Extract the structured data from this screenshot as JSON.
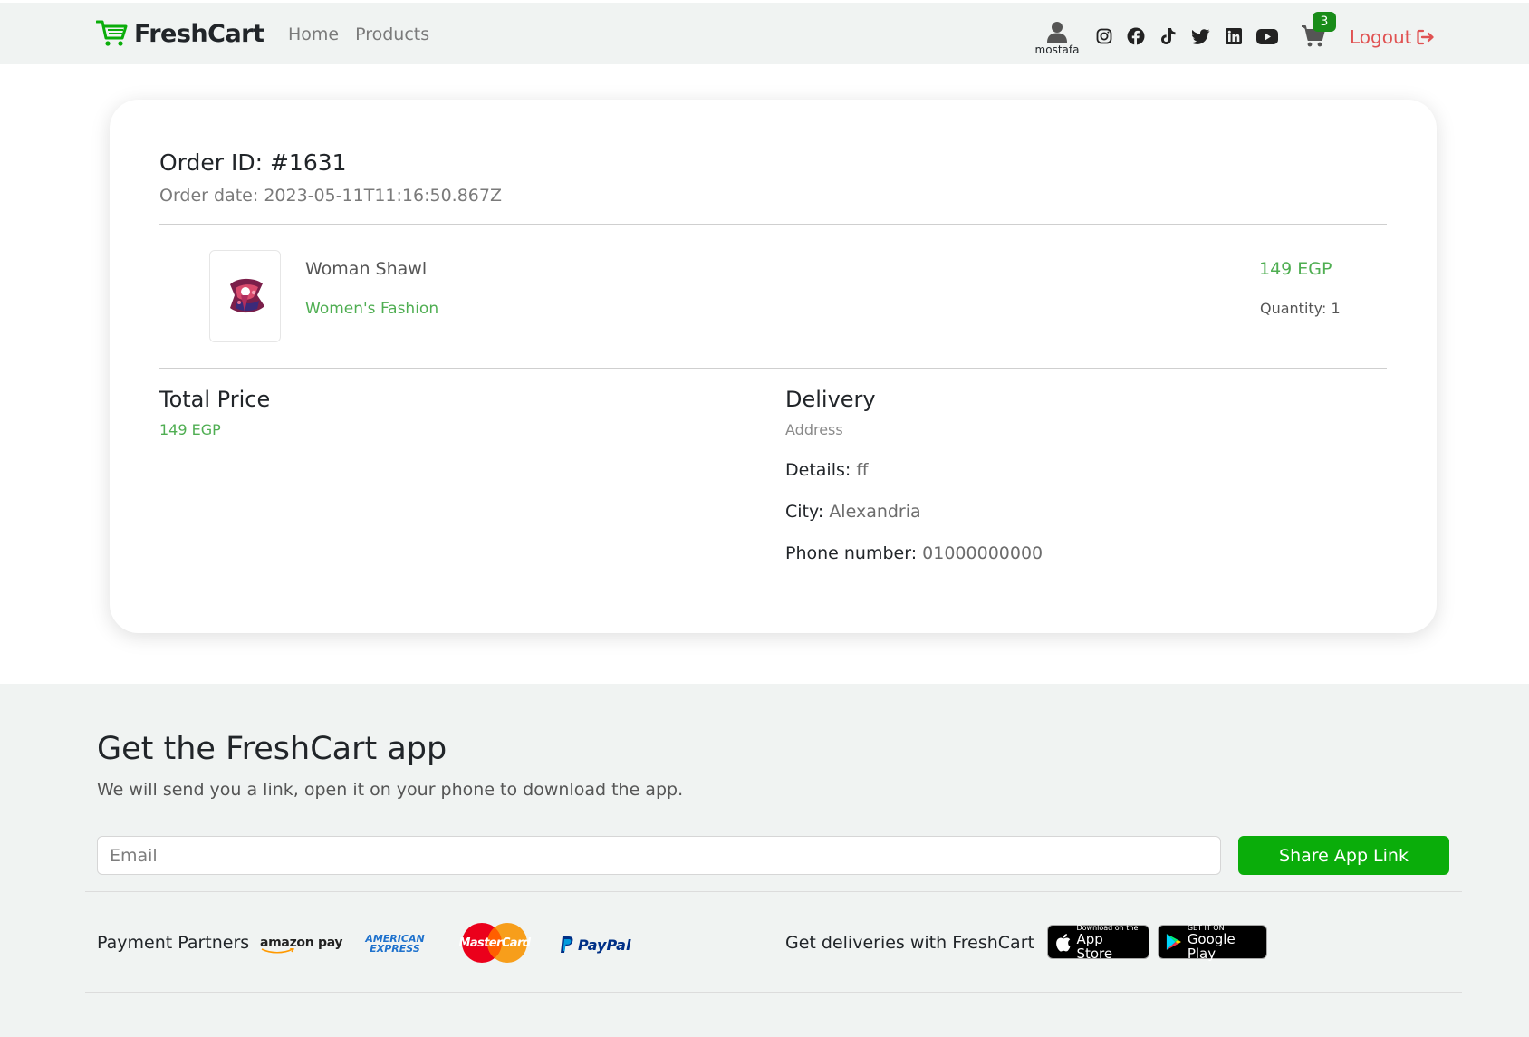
{
  "nav": {
    "brand": "FreshCart",
    "links": [
      "Home",
      "Products"
    ],
    "user_name": "mostafa",
    "social_icons": [
      "instagram-icon",
      "facebook-icon",
      "tiktok-icon",
      "twitter-icon",
      "linkedin-icon",
      "youtube-icon"
    ],
    "cart_count": "3",
    "logout_label": "Logout"
  },
  "order": {
    "title": "Order ID: #1631",
    "date": "Order date: 2023-05-11T11:16:50.867Z",
    "item": {
      "name": "Woman Shawl",
      "category": "Women's Fashion",
      "price": "149 EGP",
      "quantity": "Quantity: 1"
    },
    "total_heading": "Total Price",
    "total_value": "149 EGP",
    "delivery_heading": "Delivery",
    "delivery_sub": "Address",
    "details_label": "Details:",
    "details_value": "ff",
    "city_label": "City:",
    "city_value": "Alexandria",
    "phone_label": "Phone number:",
    "phone_value": "01000000000"
  },
  "footer": {
    "app_title": "Get the FreshCart app",
    "app_sub": "We will send you a link, open it on your phone to download the app.",
    "email_placeholder": "Email",
    "share_button": "Share App Link",
    "payment_label": "Payment Partners",
    "payment_logos": [
      "amazon pay",
      "AMERICAN EXPRESS",
      "MasterCard",
      "PayPal"
    ],
    "deliveries_label": "Get deliveries with FreshCart",
    "app_store_small": "Download on the",
    "app_store_big": "App Store",
    "google_play_small": "GET IT ON",
    "google_play_big": "Google Play"
  },
  "colors": {
    "accent_green": "#0aad0a",
    "text_green": "#4fae52",
    "logout_red": "#e05252",
    "nav_bg": "#f0f3f2"
  }
}
